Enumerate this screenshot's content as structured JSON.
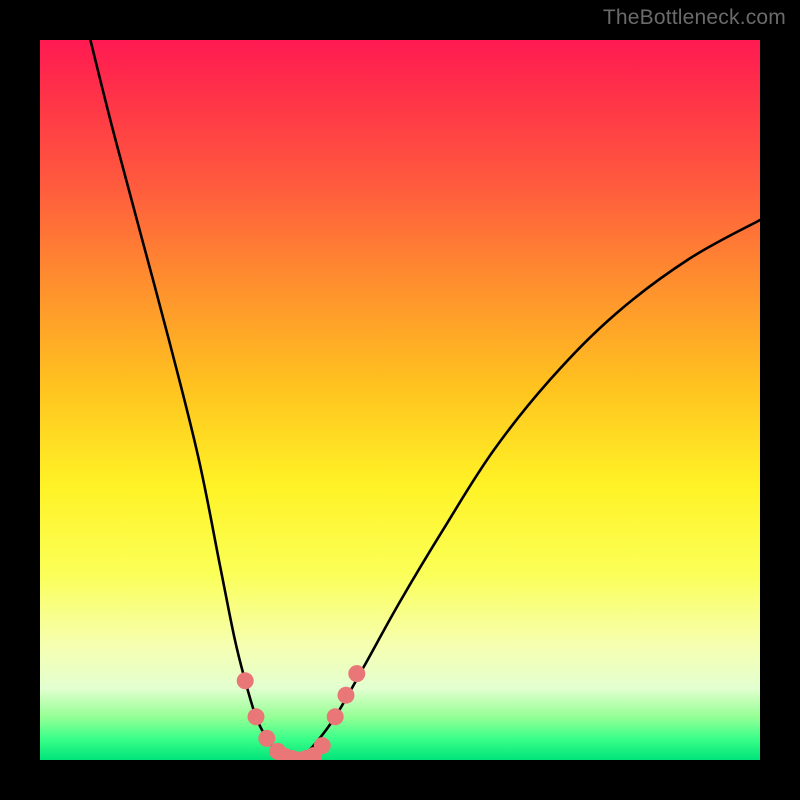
{
  "watermark": "TheBottleneck.com",
  "chart_data": {
    "type": "line",
    "title": "",
    "xlabel": "",
    "ylabel": "",
    "xlim": [
      0,
      100
    ],
    "ylim": [
      0,
      100
    ],
    "series": [
      {
        "name": "curve-left",
        "x": [
          7,
          10,
          14,
          18,
          22,
          25,
          27,
          28.5,
          30,
          31.5,
          33,
          34.5,
          36
        ],
        "values": [
          100,
          88,
          73,
          58,
          42,
          27,
          17,
          11,
          6,
          3,
          1.2,
          0.4,
          0
        ]
      },
      {
        "name": "curve-right",
        "x": [
          36,
          38,
          41,
          45,
          50,
          56,
          63,
          71,
          80,
          90,
          100
        ],
        "values": [
          0,
          2,
          6,
          13,
          22,
          32,
          43,
          53,
          62,
          69.5,
          75
        ]
      }
    ],
    "markers": {
      "name": "bottom-dots",
      "color": "#e97777",
      "points": [
        {
          "x": 28.5,
          "y": 11
        },
        {
          "x": 30,
          "y": 6
        },
        {
          "x": 31.5,
          "y": 3
        },
        {
          "x": 33,
          "y": 1.2
        },
        {
          "x": 34,
          "y": 0.5
        },
        {
          "x": 35,
          "y": 0.2
        },
        {
          "x": 36,
          "y": 0
        },
        {
          "x": 37,
          "y": 0.2
        },
        {
          "x": 38,
          "y": 0.6
        },
        {
          "x": 39.2,
          "y": 2
        },
        {
          "x": 41,
          "y": 6
        },
        {
          "x": 42.5,
          "y": 9
        },
        {
          "x": 44,
          "y": 12
        }
      ]
    },
    "gradient_stops": [
      {
        "pos": 0,
        "color": "#ff1a52"
      },
      {
        "pos": 48,
        "color": "#ffc21f"
      },
      {
        "pos": 74,
        "color": "#fbff57"
      },
      {
        "pos": 100,
        "color": "#00e47a"
      }
    ]
  }
}
